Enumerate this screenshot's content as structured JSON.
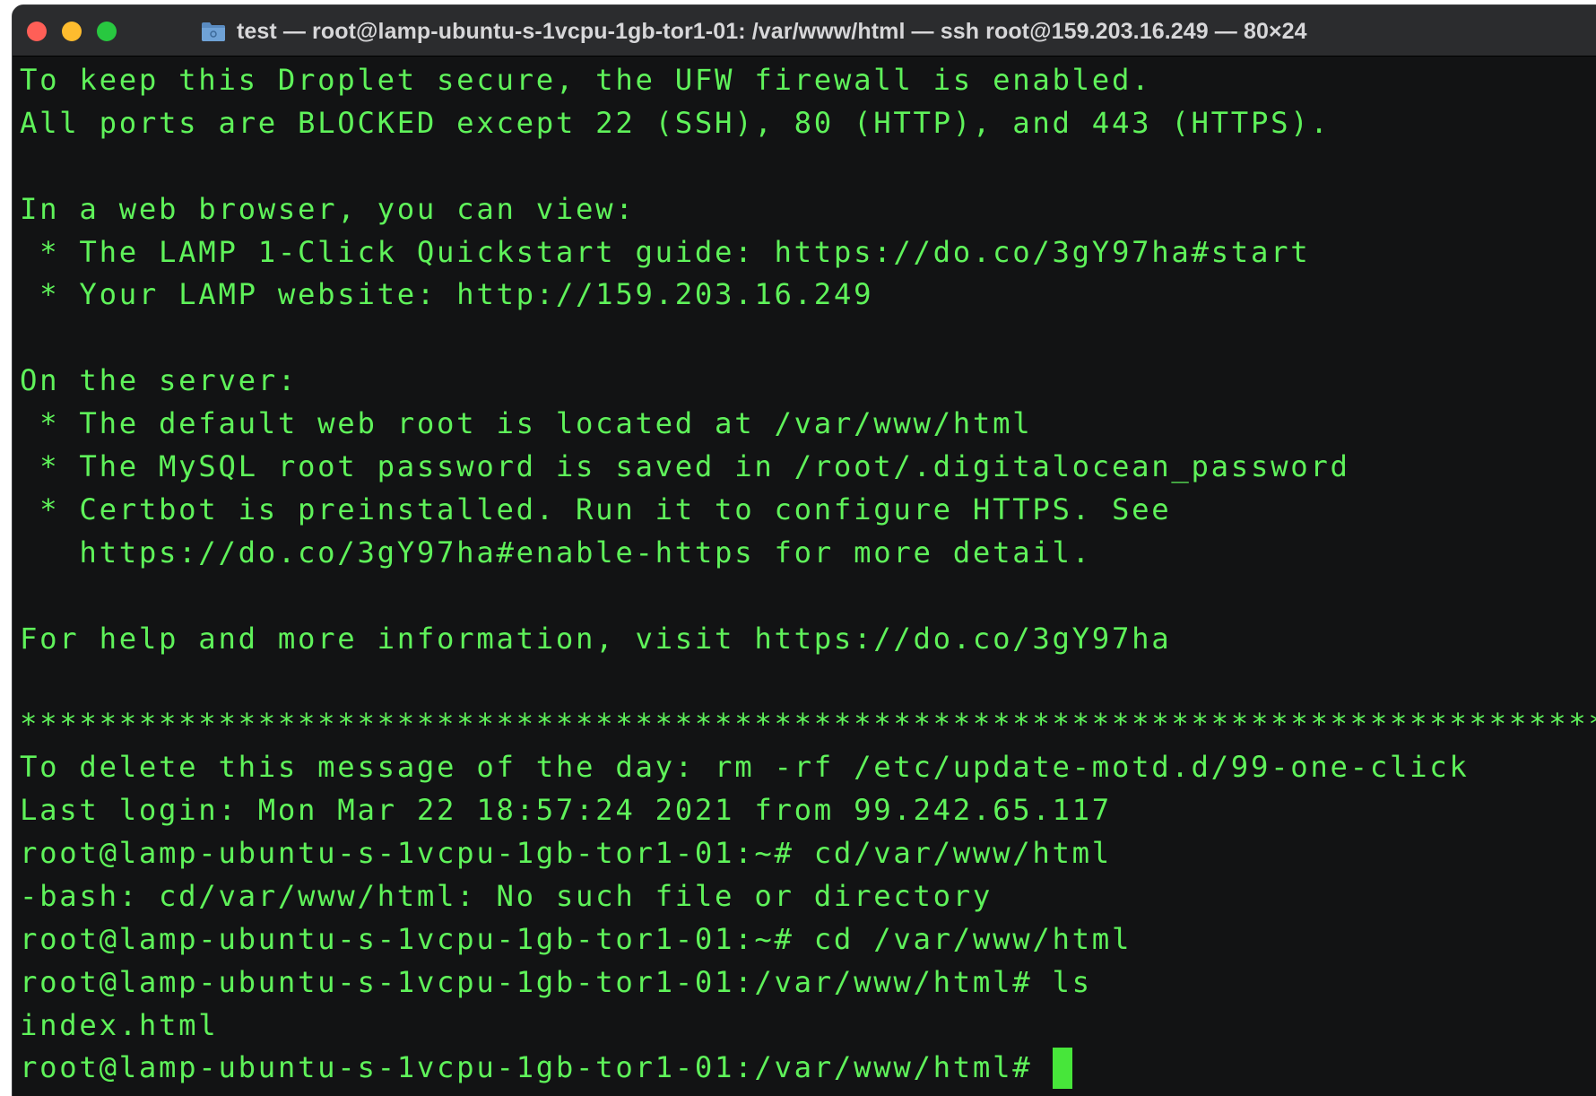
{
  "window": {
    "title": "test — root@lamp-ubuntu-s-1vcpu-1gb-tor1-01: /var/www/html — ssh root@159.203.16.249 — 80×24",
    "title_icon": "folder-icon",
    "traffic_lights": {
      "close": "#ff5f57",
      "minimize": "#febc2e",
      "maximize": "#28c840"
    }
  },
  "terminal": {
    "foreground": "#5ff25a",
    "background": "#121314",
    "lines": [
      "To keep this Droplet secure, the UFW firewall is enabled.",
      "All ports are BLOCKED except 22 (SSH), 80 (HTTP), and 443 (HTTPS).",
      "",
      "In a web browser, you can view:",
      " * The LAMP 1-Click Quickstart guide: https://do.co/3gY97ha#start",
      " * Your LAMP website: http://159.203.16.249",
      "",
      "On the server:",
      " * The default web root is located at /var/www/html",
      " * The MySQL root password is saved in /root/.digitalocean_password",
      " * Certbot is preinstalled. Run it to configure HTTPS. See",
      "   https://do.co/3gY97ha#enable-https for more detail.",
      "",
      "For help and more information, visit https://do.co/3gY97ha",
      "",
      "********************************************************************************",
      "To delete this message of the day: rm -rf /etc/update-motd.d/99-one-click",
      "Last login: Mon Mar 22 18:57:24 2021 from 99.242.65.117",
      "root@lamp-ubuntu-s-1vcpu-1gb-tor1-01:~# cd/var/www/html",
      "-bash: cd/var/www/html: No such file or directory",
      "root@lamp-ubuntu-s-1vcpu-1gb-tor1-01:~# cd /var/www/html",
      "root@lamp-ubuntu-s-1vcpu-1gb-tor1-01:/var/www/html# ls",
      "index.html"
    ],
    "prompt": "root@lamp-ubuntu-s-1vcpu-1gb-tor1-01:/var/www/html# "
  }
}
